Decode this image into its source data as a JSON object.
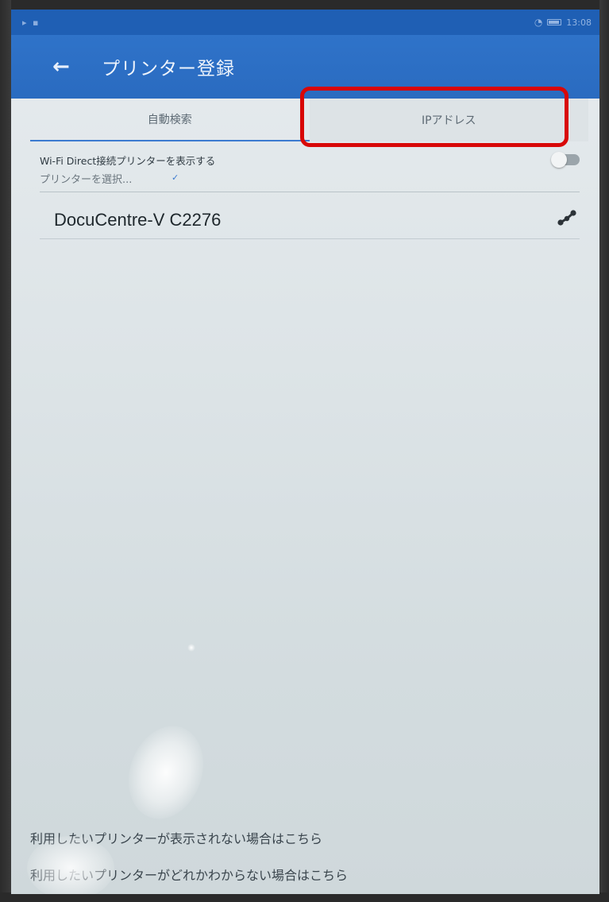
{
  "colors": {
    "app_bar": "#2a6bc0",
    "status_bar": "#1f5fb4",
    "highlight": "#d80808",
    "tab_indicator": "#3b7ad0"
  },
  "status_bar": {
    "time": "13:08"
  },
  "app_bar": {
    "title": "プリンター登録",
    "back_icon": "arrow-left"
  },
  "tabs": [
    {
      "label": "自動検索"
    },
    {
      "label": "IPアドレス"
    }
  ],
  "wifi_direct": {
    "label": "Wi-Fi Direct接続プリンターを表示する",
    "enabled": false
  },
  "printer_select": {
    "label": "プリンターを選択..."
  },
  "printers": [
    {
      "name": "DocuCentre-V C2276",
      "icon": "share-icon"
    }
  ],
  "footer": {
    "link1": "利用したいプリンターが表示されない場合はこちら",
    "link2": "利用したいプリンターがどれかわからない場合はこちら"
  }
}
